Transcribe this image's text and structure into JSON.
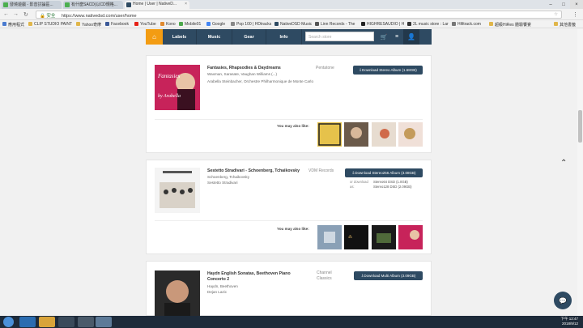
{
  "browser": {
    "tabs": [
      {
        "label": "發燒遊戲 - 影音討論區..."
      },
      {
        "label": "有什麼SACD(以CD規格..."
      },
      {
        "label": "Home | User | NativeD..."
      }
    ],
    "omnibox": {
      "secure": "安全",
      "url": "https://www.nativedsd.com/user/home"
    },
    "bookmarks": [
      "應用程式",
      "CLIP STUDIO PAINT",
      "Yahoo奇摩",
      "Facebook",
      "YouTube",
      "Kono",
      "Mobile01",
      "Google",
      "Pop 100 | HDtracks",
      "NativeDSD Music",
      "Linn Records - The",
      "HIGHRESAUDIO | H",
      "2L music store : Lar",
      "Hifitrack.com",
      "超級HiRes 體驗饗宴",
      "其他書籤"
    ]
  },
  "nav": {
    "items": [
      "Labels",
      "Music",
      "Gear",
      "Info"
    ],
    "search_placeholder": "Search store"
  },
  "albums": [
    {
      "title": "Fantasies, Rhapsodies & Daydreams",
      "composers": "Waxman, Sarasate, Vaughan Williams (...)",
      "artist": "Arabella Steinbacher, Orchestre Philharmonique de Monte Carlo",
      "label": "Pentatone",
      "button": "Download Stereo Album (1.68GB)",
      "may_also_like": "You may also like:"
    },
    {
      "title": "Sestetto Stradivari - Schoenberg, Tchaikovsky",
      "composers": "Schoenberg, Tchaikovsky",
      "artist": "Sestetto Stradivari",
      "label": "VDM Records",
      "button": "Download Stereo256 Album (3.08GB)",
      "or_download": "or download as:",
      "alt1": "Stereo64 DSD (1.0GB)",
      "alt2": "Stereo128 DSD (2.09GB)",
      "may_also_like": "You may also like:"
    },
    {
      "title": "Haydn English Sonatas, Beethoven Piano Concerto 2",
      "composers": "Haydn, Beethoven",
      "artist": "Dejan Lazic",
      "label": "Channel Classics",
      "button": "Download Multi Album (3.09GB)"
    }
  ],
  "covers": {
    "album1_text": "Fantasies",
    "album1_sub": "by Arabella"
  },
  "taskbar": {
    "time": "下午 12:47",
    "date": "2018/9/12"
  }
}
